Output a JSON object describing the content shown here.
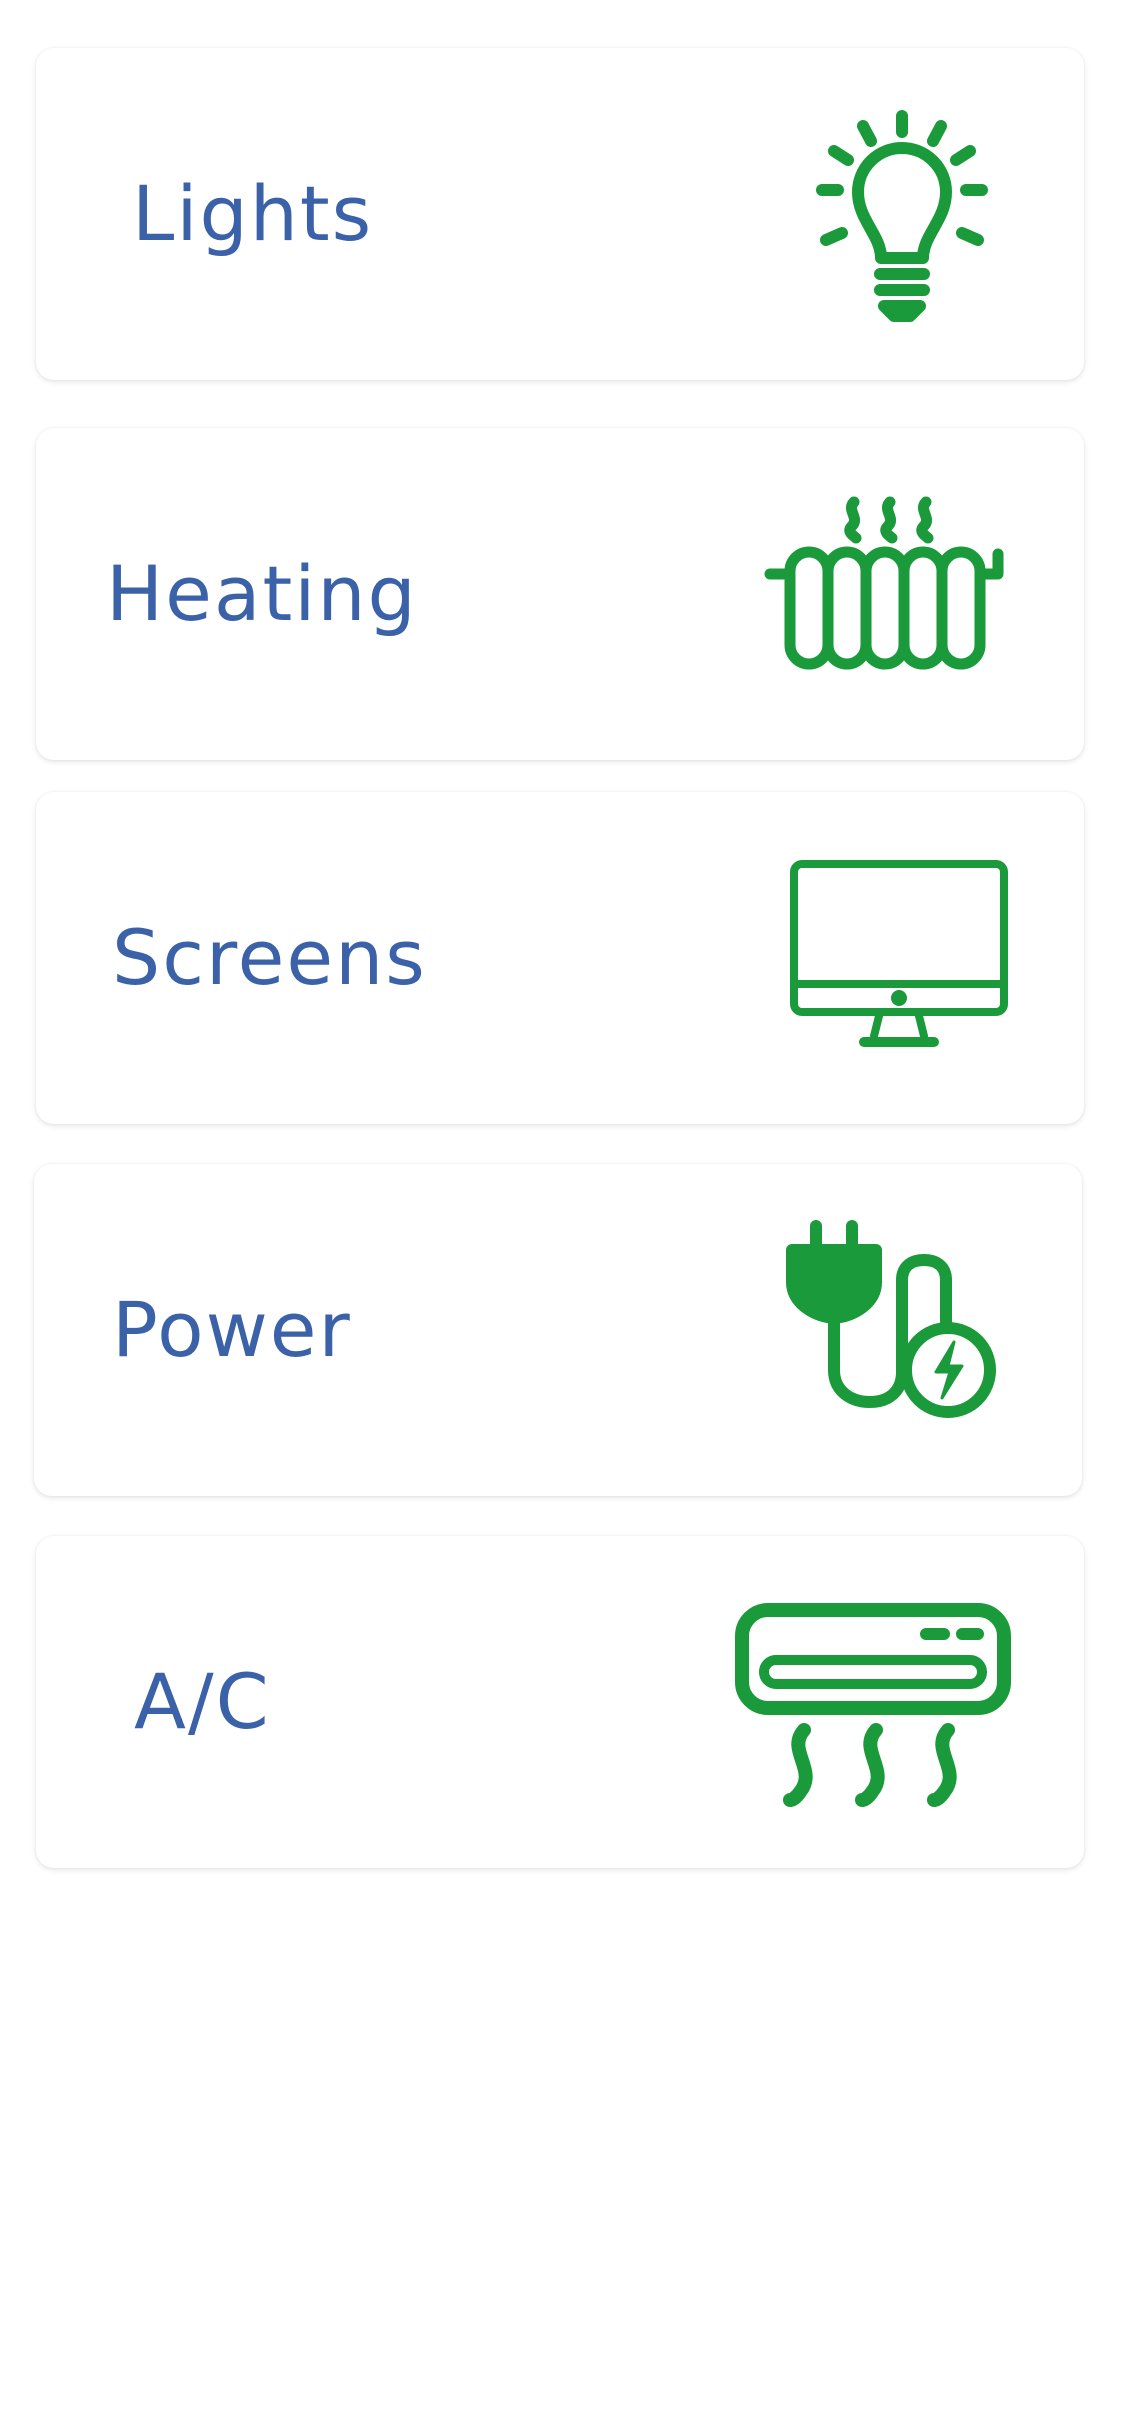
{
  "colors": {
    "label": "#3b62a8",
    "icon": "#1a9a3a",
    "card_background": "#ffffff",
    "page_background": "#ffffff"
  },
  "cards": [
    {
      "label": "Lights",
      "icon": "lightbulb-icon"
    },
    {
      "label": "Heating",
      "icon": "radiator-icon"
    },
    {
      "label": "Screens",
      "icon": "monitor-icon"
    },
    {
      "label": "Power",
      "icon": "power-plug-icon"
    },
    {
      "label": "A/C",
      "icon": "air-conditioner-icon"
    }
  ]
}
